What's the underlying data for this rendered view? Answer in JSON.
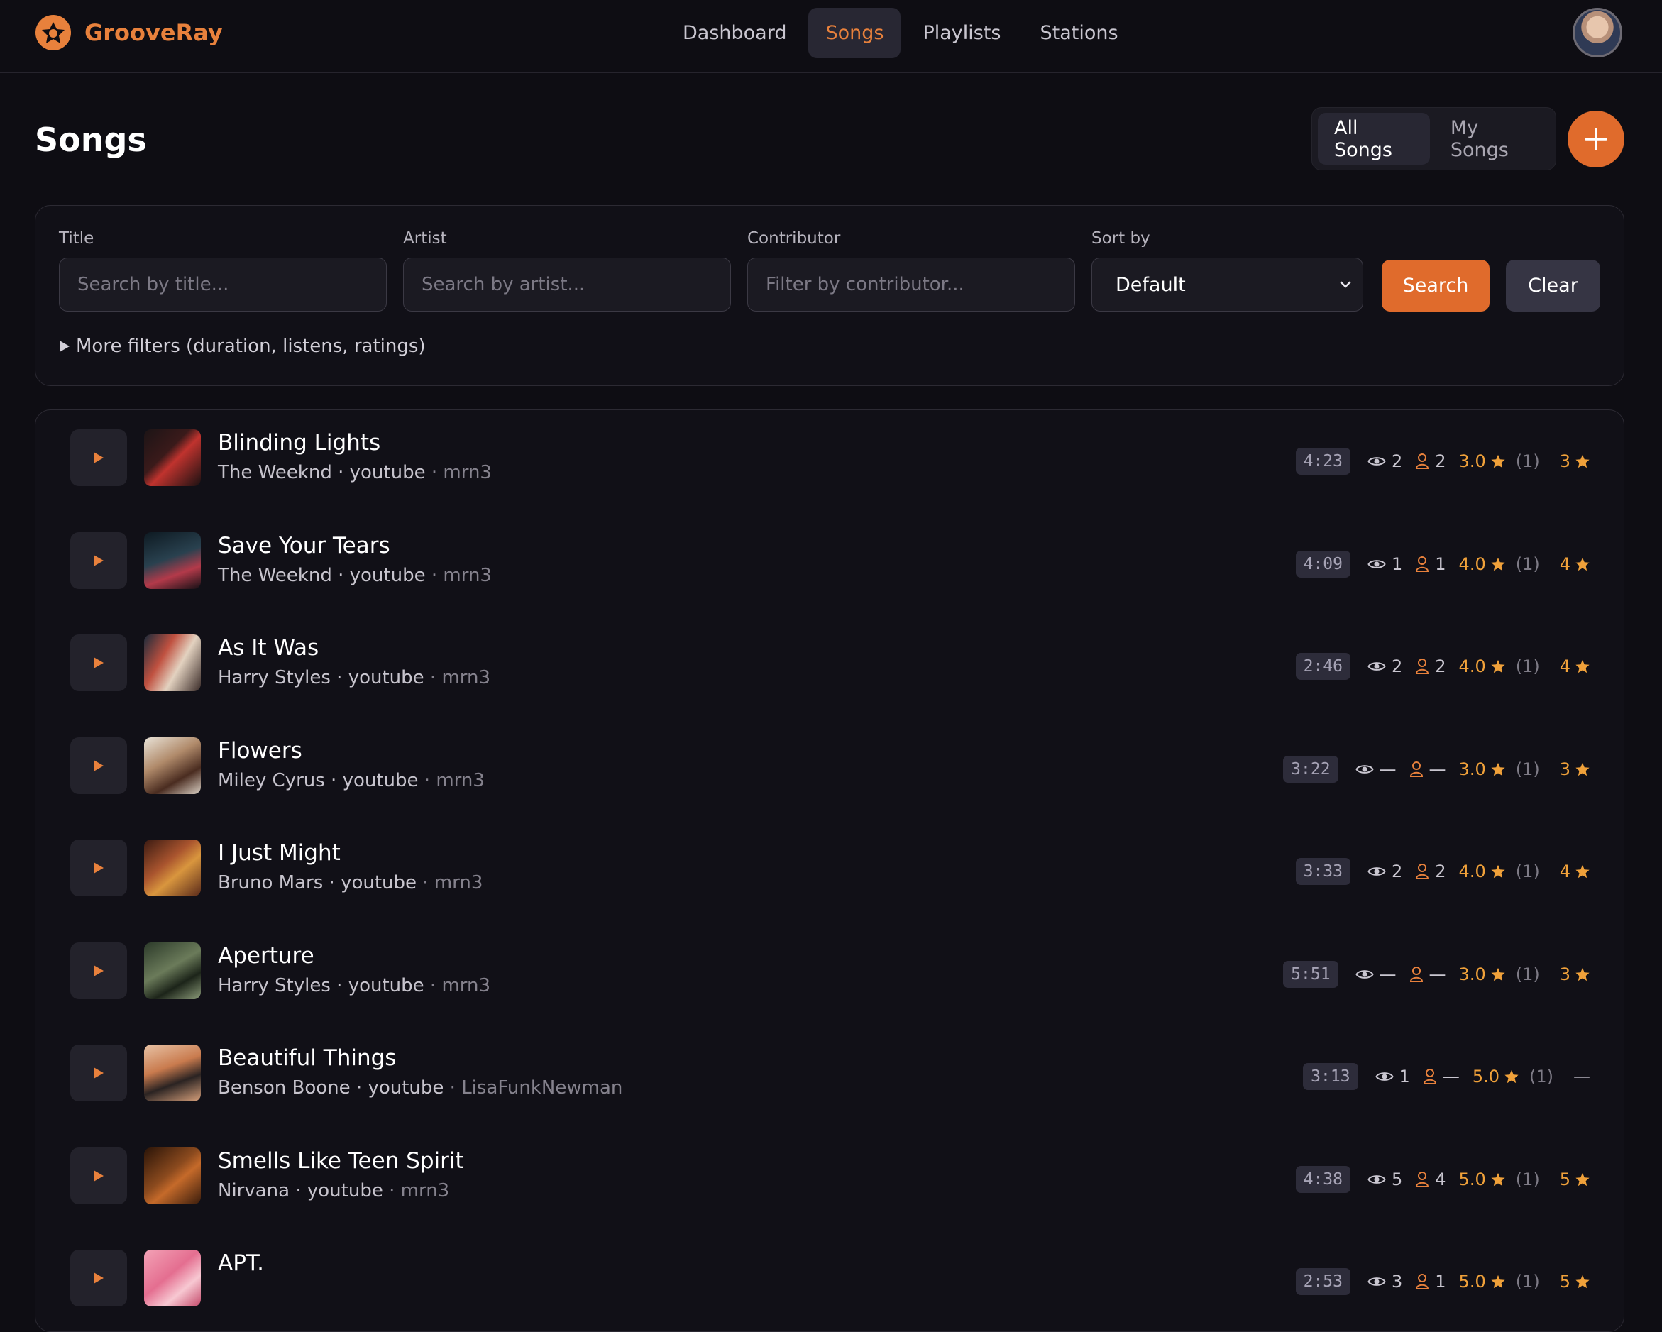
{
  "app": {
    "name": "GrooveRay",
    "accent": "#e06b2c"
  },
  "nav": {
    "items": [
      {
        "label": "Dashboard",
        "active": false
      },
      {
        "label": "Songs",
        "active": true
      },
      {
        "label": "Playlists",
        "active": false
      },
      {
        "label": "Stations",
        "active": false
      }
    ]
  },
  "page": {
    "title": "Songs",
    "scope_tabs": [
      {
        "label": "All Songs",
        "active": true
      },
      {
        "label": "My Songs",
        "active": false
      }
    ]
  },
  "filters": {
    "title_label": "Title",
    "title_placeholder": "Search by title...",
    "artist_label": "Artist",
    "artist_placeholder": "Search by artist...",
    "contributor_label": "Contributor",
    "contributor_placeholder": "Filter by contributor...",
    "sort_label": "Sort by",
    "sort_value": "Default",
    "search_label": "Search",
    "clear_label": "Clear",
    "more_label": "More filters (duration, listens, ratings)"
  },
  "songs": [
    {
      "title": "Blinding Lights",
      "artist": "The Weeknd",
      "source": "youtube",
      "contributor": "mrn3",
      "duration": "4:23",
      "views": "2",
      "listeners": "2",
      "rating": "3.0",
      "rating_count": "(1)",
      "my_rating": "3"
    },
    {
      "title": "Save Your Tears",
      "artist": "The Weeknd",
      "source": "youtube",
      "contributor": "mrn3",
      "duration": "4:09",
      "views": "1",
      "listeners": "1",
      "rating": "4.0",
      "rating_count": "(1)",
      "my_rating": "4"
    },
    {
      "title": "As It Was",
      "artist": "Harry Styles",
      "source": "youtube",
      "contributor": "mrn3",
      "duration": "2:46",
      "views": "2",
      "listeners": "2",
      "rating": "4.0",
      "rating_count": "(1)",
      "my_rating": "4"
    },
    {
      "title": "Flowers",
      "artist": "Miley Cyrus",
      "source": "youtube",
      "contributor": "mrn3",
      "duration": "3:22",
      "views": "—",
      "listeners": "—",
      "rating": "3.0",
      "rating_count": "(1)",
      "my_rating": "3"
    },
    {
      "title": "I Just Might",
      "artist": "Bruno Mars",
      "source": "youtube",
      "contributor": "mrn3",
      "duration": "3:33",
      "views": "2",
      "listeners": "2",
      "rating": "4.0",
      "rating_count": "(1)",
      "my_rating": "4"
    },
    {
      "title": "Aperture",
      "artist": "Harry Styles",
      "source": "youtube",
      "contributor": "mrn3",
      "duration": "5:51",
      "views": "—",
      "listeners": "—",
      "rating": "3.0",
      "rating_count": "(1)",
      "my_rating": "3"
    },
    {
      "title": "Beautiful Things",
      "artist": "Benson Boone",
      "source": "youtube",
      "contributor": "LisaFunkNewman",
      "duration": "3:13",
      "views": "1",
      "listeners": "—",
      "rating": "5.0",
      "rating_count": "(1)",
      "my_rating": "—"
    },
    {
      "title": "Smells Like Teen Spirit",
      "artist": "Nirvana",
      "source": "youtube",
      "contributor": "mrn3",
      "duration": "4:38",
      "views": "5",
      "listeners": "4",
      "rating": "5.0",
      "rating_count": "(1)",
      "my_rating": "5"
    },
    {
      "title": "APT.",
      "artist": "",
      "source": "",
      "contributor": "",
      "duration": "2:53",
      "views": "3",
      "listeners": "1",
      "rating": "5.0",
      "rating_count": "(1)",
      "my_rating": "5"
    }
  ]
}
